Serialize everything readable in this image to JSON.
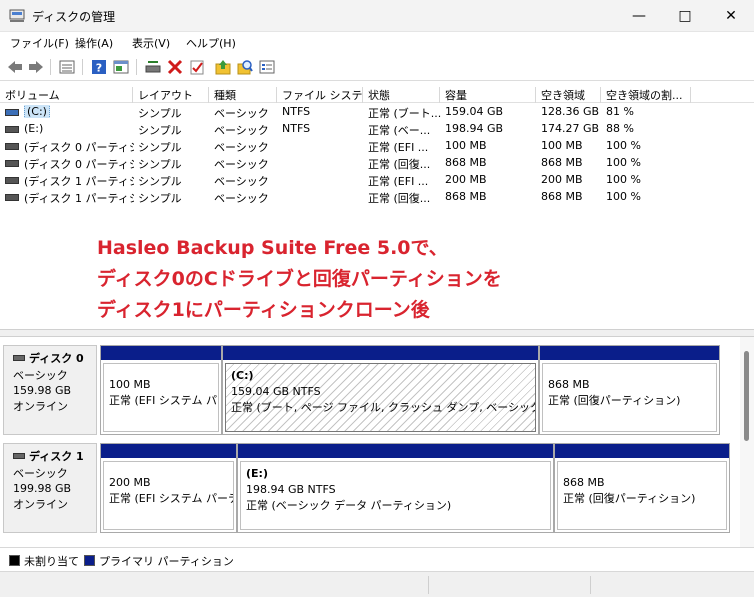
{
  "window": {
    "title": "ディスクの管理",
    "minimize": "—",
    "maximize": "□",
    "close": "✕"
  },
  "menu": [
    {
      "label": "ファイル(F)"
    },
    {
      "label": "操作(A)"
    },
    {
      "label": "表示(V)"
    },
    {
      "label": "ヘルプ(H)"
    }
  ],
  "toolbar": {
    "icons": [
      "back-arrow-icon",
      "forward-arrow-icon",
      "volume-list-icon",
      "help-icon",
      "properties-icon",
      "connect-drive-icon",
      "delete-icon",
      "check-icon",
      "up-folder-icon",
      "search-icon",
      "view-list-icon"
    ],
    "delete_color": "#d01b1b"
  },
  "list": {
    "headers": [
      "ボリューム",
      "レイアウト",
      "種類",
      "ファイル システム",
      "状態",
      "容量",
      "空き領域",
      "空き領域の割..."
    ],
    "rows": [
      {
        "volume": "(C:)",
        "layout": "シンプル",
        "type": "ベーシック",
        "fs": "NTFS",
        "status": "正常 (ブート...",
        "capacity": "159.04 GB",
        "free": "128.36 GB",
        "pct": "81 %"
      },
      {
        "volume": "(E:)",
        "layout": "シンプル",
        "type": "ベーシック",
        "fs": "NTFS",
        "status": "正常 (ベー...",
        "capacity": "198.94 GB",
        "free": "174.27 GB",
        "pct": "88 %"
      },
      {
        "volume": "(ディスク 0 パーティシ...",
        "layout": "シンプル",
        "type": "ベーシック",
        "fs": "",
        "status": "正常 (EFI ...",
        "capacity": "100 MB",
        "free": "100 MB",
        "pct": "100 %"
      },
      {
        "volume": "(ディスク 0 パーティシ...",
        "layout": "シンプル",
        "type": "ベーシック",
        "fs": "",
        "status": "正常 (回復...",
        "capacity": "868 MB",
        "free": "868 MB",
        "pct": "100 %"
      },
      {
        "volume": "(ディスク 1 パーティシ...",
        "layout": "シンプル",
        "type": "ベーシック",
        "fs": "",
        "status": "正常 (EFI ...",
        "capacity": "200 MB",
        "free": "200 MB",
        "pct": "100 %"
      },
      {
        "volume": "(ディスク 1 パーティシ...",
        "layout": "シンプル",
        "type": "ベーシック",
        "fs": "",
        "status": "正常 (回復...",
        "capacity": "868 MB",
        "free": "868 MB",
        "pct": "100 %"
      }
    ]
  },
  "overlay": {
    "line1": "Hasleo Backup Suite Free 5.0で、",
    "line2": "ディスク0のCドライブと回復パーティションを",
    "line3": "ディスク1にパーティションクローン後",
    "color": "#d9242f"
  },
  "disks": [
    {
      "name": "ディスク 0",
      "type": "ベーシック",
      "size": "159.98 GB",
      "state": "オンライン",
      "partitions": [
        {
          "label": "",
          "size": "100 MB",
          "status": "正常 (EFI システム パー"
        },
        {
          "label": "(C:)",
          "size": "159.04 GB NTFS",
          "status": "正常 (ブート, ページ ファイル, クラッシュ ダンプ, ベーシック データ パー"
        },
        {
          "label": "",
          "size": "868 MB",
          "status": "正常 (回復パーティション)"
        }
      ]
    },
    {
      "name": "ディスク 1",
      "type": "ベーシック",
      "size": "199.98 GB",
      "state": "オンライン",
      "partitions": [
        {
          "label": "",
          "size": "200 MB",
          "status": "正常 (EFI システム パーティ"
        },
        {
          "label": "(E:)",
          "size": "198.94 GB NTFS",
          "status": "正常 (ベーシック データ パーティション)"
        },
        {
          "label": "",
          "size": "868 MB",
          "status": "正常 (回復パーティション)"
        }
      ]
    }
  ],
  "legend": {
    "unallocated": "未割り当て",
    "primary": "プライマリ パーティション",
    "unallocated_color": "#000000",
    "primary_color": "#0a1e8a"
  }
}
